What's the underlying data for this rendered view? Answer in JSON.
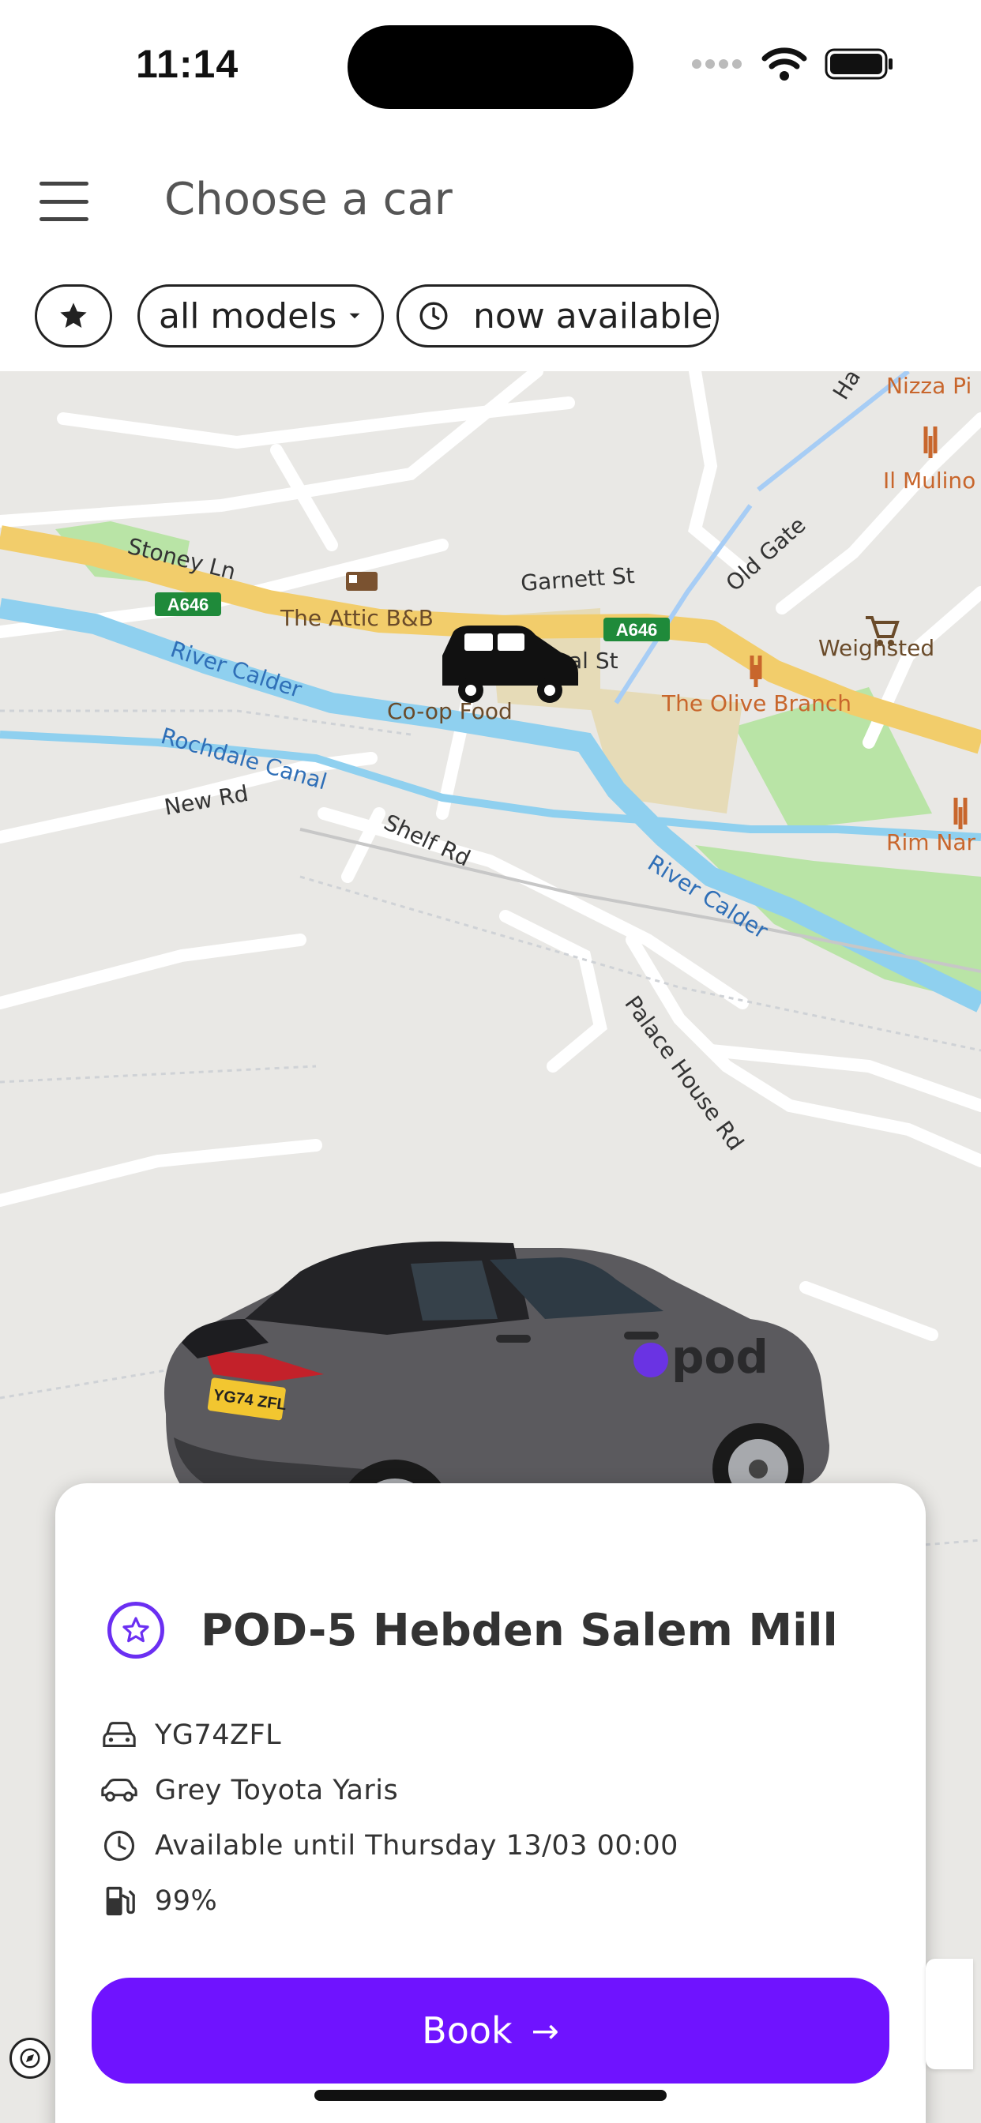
{
  "status_bar": {
    "time": "11:14"
  },
  "header": {
    "title": "Choose a car"
  },
  "filters": {
    "models_label": "all models",
    "availability_label": "now available"
  },
  "map": {
    "labels": {
      "stoney_ln": "Stoney Ln",
      "a646_left": "A646",
      "a646_right": "A646",
      "attic_bb": "The Attic B&B",
      "garnett_st": "Garnett St",
      "hall_st": "al St",
      "old_gate": "Old Gate",
      "nizza": "Nizza Pi",
      "il_mulino": "Il Mulino",
      "weighsted": "Weighsted",
      "olive_branch": "The Olive Branch",
      "coop_food": "Co-op Food",
      "river_calder_1": "River Calder",
      "rochdale_canal": "Rochdale Canal",
      "new_rd": "New Rd",
      "shelf_rd": "Shelf Rd",
      "river_calder_2": "River Calder",
      "rim_nam": "Rim Nar",
      "palace_house_rd": "Palace House Rd",
      "ha": "Ha"
    },
    "colors": {
      "road_major": "#f2cd6b",
      "water": "#8fd0ef",
      "park": "#b9e4a6",
      "land": "#e9e8e5"
    }
  },
  "car": {
    "title": "POD-5 Hebden Salem Mill",
    "registration": "YG74ZFL",
    "model": "Grey Toyota Yaris",
    "availability": "Available until Thursday 13/03 00:00",
    "fuel": "99%",
    "plate_text": "YG74 ZFL",
    "brand_text": "pod"
  },
  "actions": {
    "book_label": "Book"
  },
  "theme": {
    "accent": "#6f13ff",
    "favorite_outline": "#6b2ff2"
  }
}
